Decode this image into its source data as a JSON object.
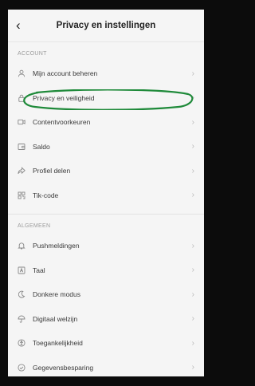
{
  "header": {
    "back_icon": "chevron-left-icon",
    "title": "Privacy en instellingen"
  },
  "account": {
    "section_label": "ACCOUNT",
    "items": [
      {
        "label": "Mijn account beheren",
        "icon": "person-icon"
      },
      {
        "label": "Privacy en veiligheid",
        "icon": "lock-icon"
      },
      {
        "label": "Contentvoorkeuren",
        "icon": "video-icon"
      },
      {
        "label": "Saldo",
        "icon": "wallet-icon"
      },
      {
        "label": "Profiel delen",
        "icon": "share-icon"
      },
      {
        "label": "Tik-code",
        "icon": "qr-code-icon"
      }
    ]
  },
  "general": {
    "section_label": "ALGEMEEN",
    "items": [
      {
        "label": "Pushmeldingen",
        "icon": "bell-icon"
      },
      {
        "label": "Taal",
        "icon": "language-icon"
      },
      {
        "label": "Donkere modus",
        "icon": "moon-icon"
      },
      {
        "label": "Digitaal welzijn",
        "icon": "umbrella-icon"
      },
      {
        "label": "Toegankelijkheid",
        "icon": "accessibility-icon"
      },
      {
        "label": "Gegevensbesparing",
        "icon": "data-saver-icon"
      }
    ]
  },
  "chevron": "›",
  "colors": {
    "highlight_circle": "#1f8a3a",
    "section_label": "#9b9b9b",
    "background": "#f5f5f5"
  }
}
